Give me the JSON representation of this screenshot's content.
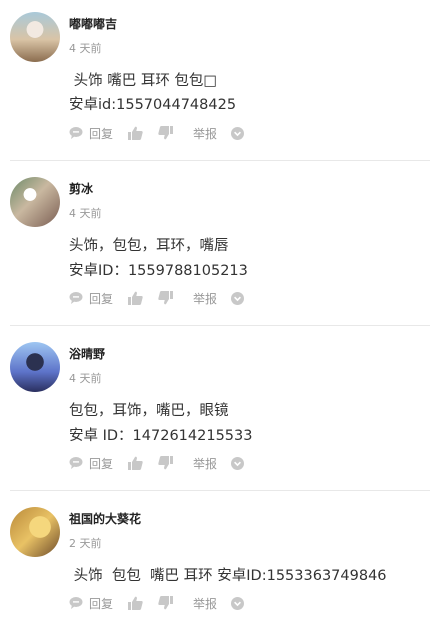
{
  "comments": [
    {
      "author": "嘟嘟嘟吉",
      "time": "4 天前",
      "lines": [
        " 头饰 嘴巴 耳环 包包□",
        "安卓id:1557044748425"
      ]
    },
    {
      "author": "剪冰",
      "time": "4 天前",
      "lines": [
        "头饰，包包，耳环，嘴唇",
        "安卓ID：1559788105213"
      ]
    },
    {
      "author": "浴晴野",
      "time": "4 天前",
      "lines": [
        "包包，耳饰，嘴巴，眼镜",
        "安卓 ID：1472614215533"
      ]
    },
    {
      "author": "祖国的大葵花",
      "time": "2 天前",
      "lines": [
        " 头饰  包包  嘴巴 耳环 安卓ID:1553363749846"
      ]
    }
  ],
  "actions": {
    "reply_label": "回复",
    "report_label": "举报",
    "reply_icon": "speech-bubble-icon",
    "like_icon": "thumbs-up-icon",
    "dislike_icon": "thumbs-down-icon",
    "more_icon": "chevron-down-circle-icon"
  },
  "colors": {
    "icon_gray": "#c8c8c8",
    "meta_gray": "#999999",
    "text": "#333333",
    "divider": "#e8e8e8"
  }
}
